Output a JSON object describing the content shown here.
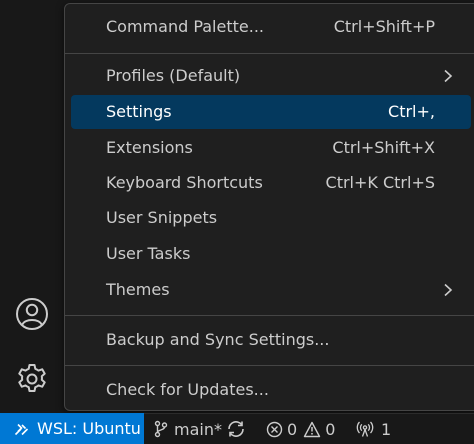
{
  "menu": {
    "items": [
      {
        "label": "Command Palette...",
        "shortcut": "Ctrl+Shift+P"
      },
      {
        "label": "Profiles (Default)",
        "submenu": true
      },
      {
        "label": "Settings",
        "shortcut": "Ctrl+,",
        "selected": true
      },
      {
        "label": "Extensions",
        "shortcut": "Ctrl+Shift+X"
      },
      {
        "label": "Keyboard Shortcuts",
        "shortcut": "Ctrl+K Ctrl+S"
      },
      {
        "label": "User Snippets"
      },
      {
        "label": "User Tasks"
      },
      {
        "label": "Themes",
        "submenu": true
      },
      {
        "label": "Backup and Sync Settings..."
      },
      {
        "label": "Check for Updates..."
      }
    ]
  },
  "activity_bar": {
    "accounts_icon": "accounts-icon",
    "manage_icon": "gear-icon"
  },
  "status_bar": {
    "remote_label": "WSL: Ubuntu",
    "branch": "main*",
    "errors": "0",
    "warnings": "0",
    "ports": "1"
  },
  "colors": {
    "remote_background": "#0078d4",
    "selection_background": "#04395e",
    "menu_background": "#1f1f1f",
    "workbench_background": "#181818"
  }
}
